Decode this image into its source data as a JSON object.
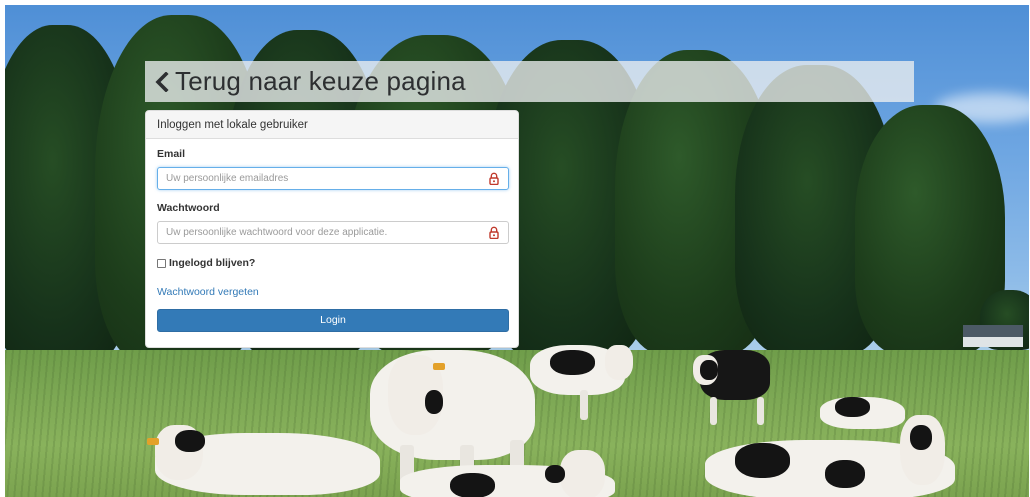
{
  "back_link": {
    "label": "Terug naar keuze pagina",
    "icon": "chevron-left-icon"
  },
  "login_panel": {
    "heading": "Inloggen met lokale gebruiker",
    "email": {
      "label": "Email",
      "placeholder": "Uw persoonlijke emailadres",
      "value": "",
      "icon": "lock-icon"
    },
    "password": {
      "label": "Wachtwoord",
      "placeholder": "Uw persoonlijke wachtwoord voor deze applicatie.",
      "value": "",
      "icon": "lock-icon"
    },
    "remember": {
      "label": "Ingelogd blijven?",
      "checked": false
    },
    "forgot_link": "Wachtwoord vergeten",
    "submit_label": "Login"
  },
  "colors": {
    "primary": "#337ab7",
    "link": "#337ab7",
    "lock_icon": "#c0392b",
    "focus_border": "#66afe9"
  }
}
